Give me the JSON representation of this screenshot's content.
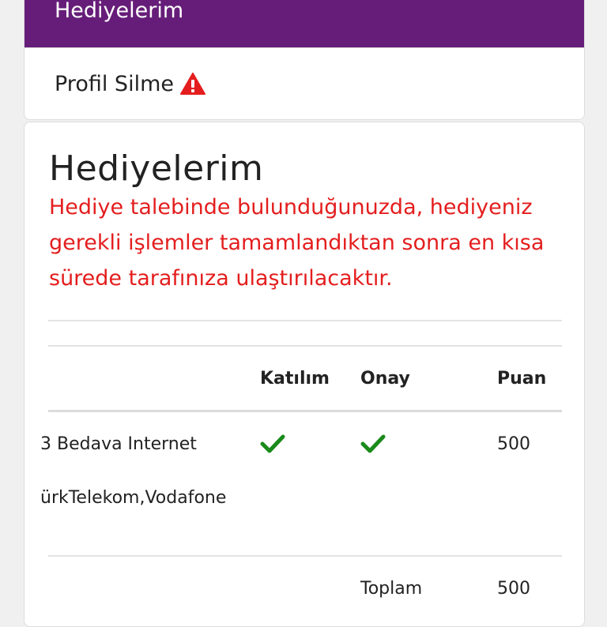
{
  "menu": {
    "active_label": "Hediyelerim",
    "profile_delete_label": "Profil Silme",
    "warning_icon_color": "#e41e1e"
  },
  "content": {
    "title": "Hediyelerim",
    "notice": "Hediye talebinde bulunduğunuzda, hediyeniz gerekli işlemler tamamlandıktan sonra en kısa sürede tarafınıza ulaştırılacaktır.",
    "table": {
      "headers": {
        "participation": "Katılım",
        "approval": "Onay",
        "points": "Puan"
      },
      "rows": [
        {
          "gift_line1": "3 Bedava Internet",
          "gift_line2": "ürkTelekom,Vodafone",
          "participation": "check",
          "approval": "check",
          "points": "500"
        }
      ],
      "total_label": "Toplam",
      "total_value": "500"
    }
  },
  "colors": {
    "brand_purple": "#661d79",
    "notice_red": "#e41e1e",
    "check_green": "#1a8a1a"
  }
}
